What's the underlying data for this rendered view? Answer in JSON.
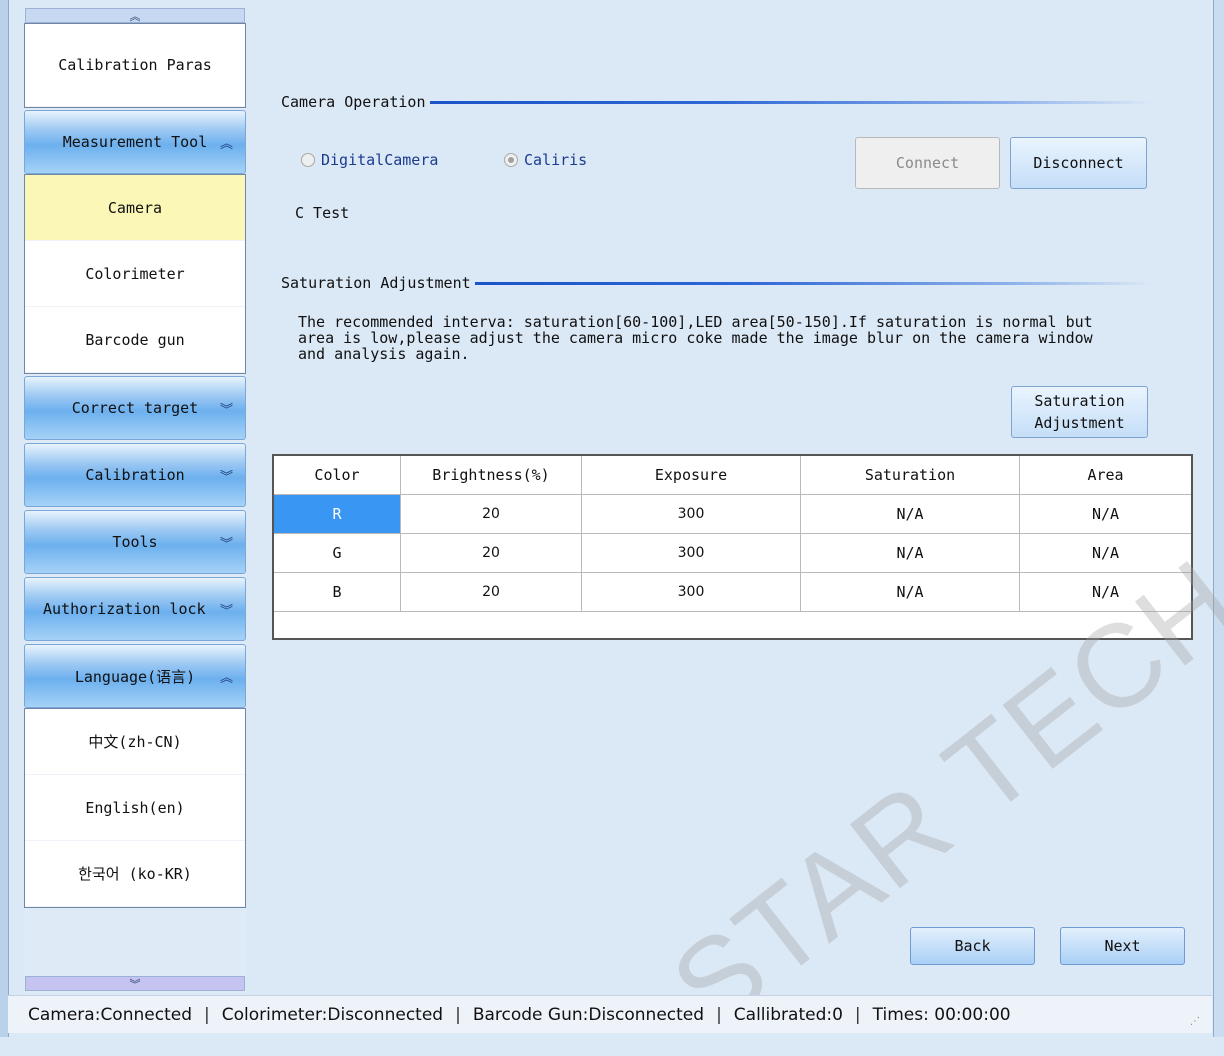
{
  "sidebar": {
    "scroll_up": "⌃⌃",
    "scroll_down": "⌄⌄",
    "items": {
      "calibration_paras": "Calibration Paras",
      "camera": "Camera",
      "colorimeter": "Colorimeter",
      "barcode_gun": "Barcode gun",
      "zh": "中文(zh-CN)",
      "en": "English(en)",
      "ko": "한국어 (ko-KR)"
    },
    "headers": {
      "measurement_tool": "Measurement Tool",
      "correct_target": "Correct target",
      "calibration": "Calibration",
      "tools": "Tools",
      "authorization_lock": "Authorization lock",
      "language": "Language(语言)"
    },
    "chev_up": "«",
    "chev_down": "»"
  },
  "camera_operation": {
    "title": "Camera Operation",
    "radio_digital": "DigitalCamera",
    "radio_caliris": "Caliris",
    "connect": "Connect",
    "disconnect": "Disconnect",
    "c_test": "C Test"
  },
  "saturation": {
    "title": "Saturation Adjustment",
    "description": "The recommended interva: saturation[60-100],LED area[50-150].If saturation is normal but\narea is low,please adjust the camera micro coke made the image blur on the camera window\nand analysis again.",
    "button": "Saturation\nAdjustment"
  },
  "table": {
    "headers": [
      "Color",
      "Brightness(%)",
      "Exposure",
      "Saturation",
      "Area"
    ],
    "rows": [
      [
        "R",
        "20",
        "300",
        "N/A",
        "N/A"
      ],
      [
        "G",
        "20",
        "300",
        "N/A",
        "N/A"
      ],
      [
        "B",
        "20",
        "300",
        "N/A",
        "N/A"
      ]
    ]
  },
  "nav": {
    "back": "Back",
    "next": "Next"
  },
  "watermark": "STAR TECH CO., LTD",
  "status": {
    "camera": "Camera:Connected",
    "colorimeter": "Colorimeter:Disconnected",
    "barcode": "Barcode Gun:Disconnected",
    "calibrated": "Callibrated:0",
    "times": "Times: 00:00:00",
    "separator": "|"
  },
  "colors": {
    "accent": "#1a54c8",
    "selected_item": "#fbf7b6",
    "selected_cell": "#3a96f3"
  }
}
